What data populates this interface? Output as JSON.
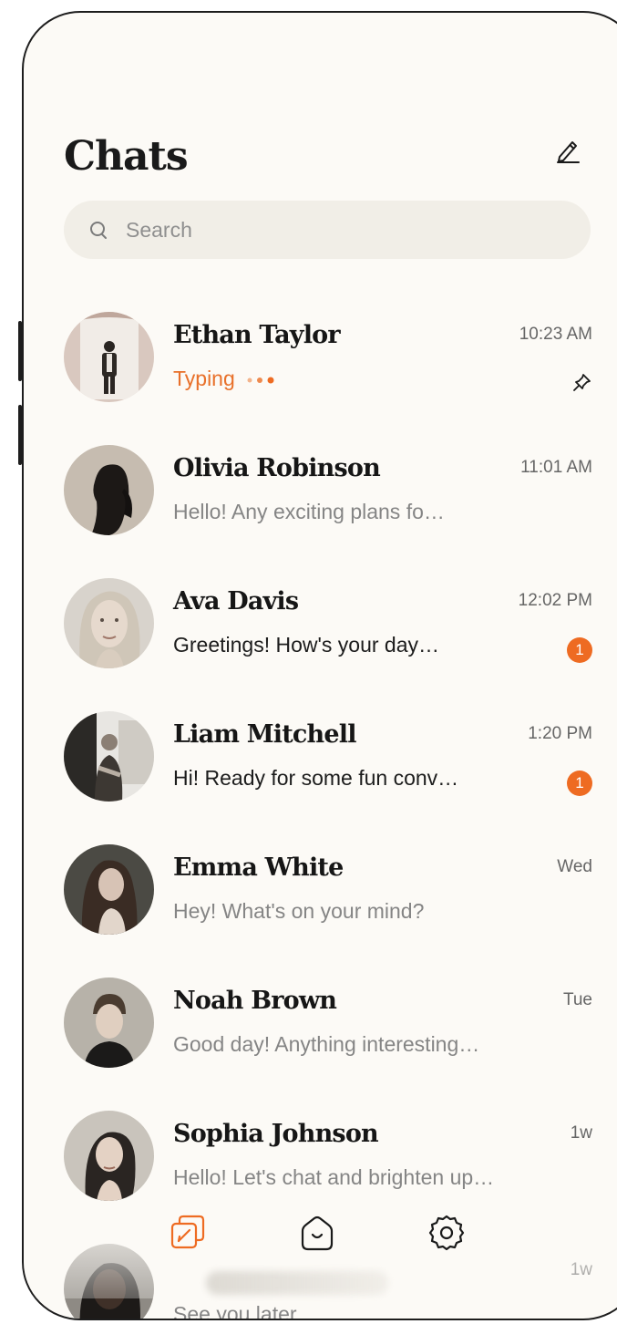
{
  "header": {
    "title": "Chats",
    "compose_icon": "edit-pencil-icon"
  },
  "search": {
    "placeholder": "Search",
    "icon": "search-icon"
  },
  "chats": [
    {
      "name": "Ethan Taylor",
      "time": "10:23 AM",
      "preview": "Typing",
      "status": "typing",
      "pinned": true,
      "pin_icon": "pin-icon"
    },
    {
      "name": "Olivia Robinson",
      "time": "11:01 AM",
      "preview": "Hello! Any exciting plans fo…",
      "status": "read"
    },
    {
      "name": "Ava Davis",
      "time": "12:02 PM",
      "preview": "Greetings! How's your day…",
      "status": "unread",
      "unread_count": "1"
    },
    {
      "name": "Liam Mitchell",
      "time": "1:20 PM",
      "preview": "Hi! Ready for some fun conv…",
      "status": "unread",
      "unread_count": "1"
    },
    {
      "name": "Emma White",
      "time": "Wed",
      "preview": "Hey! What's on your mind?",
      "status": "read"
    },
    {
      "name": "Noah Brown",
      "time": "Tue",
      "preview": "Good day! Anything interesting…",
      "status": "read"
    },
    {
      "name": "Sophia Johnson",
      "time": "1w",
      "preview": "Hello! Let's chat and brighten up…",
      "status": "read"
    },
    {
      "name": "",
      "time": "1w",
      "preview": "See you later",
      "status": "read"
    }
  ],
  "tabbar": {
    "items": [
      {
        "icon": "chats-tab-icon",
        "active": true
      },
      {
        "icon": "home-tab-icon",
        "active": false
      },
      {
        "icon": "settings-gear-icon",
        "active": false
      }
    ]
  },
  "colors": {
    "accent": "#ee6b22",
    "background": "#fcfaf6",
    "search_bg": "#f1eee7"
  }
}
